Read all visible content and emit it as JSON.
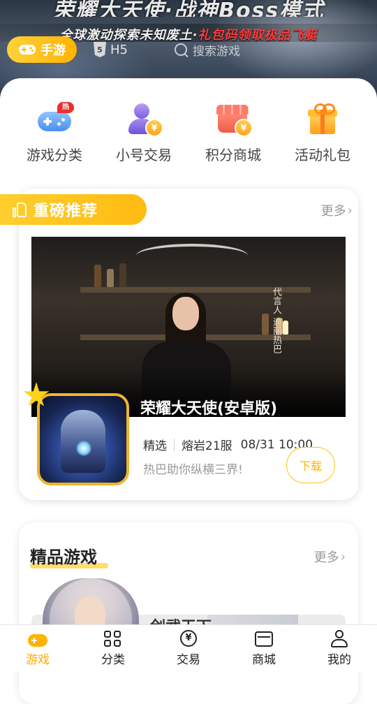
{
  "banner": {
    "headline": "荣耀大天使·战神Boss模式",
    "subline_part1": "全球激动探索未知废土·",
    "subline_part2": "礼包码领取极品飞艇",
    "platform_tag": "手游",
    "h5_label": "H5",
    "search_label": "搜索游戏"
  },
  "quick_menu": [
    {
      "label": "游戏分类",
      "icon": "gamepad-icon",
      "badge": "热"
    },
    {
      "label": "小号交易",
      "icon": "account-trade-icon"
    },
    {
      "label": "积分商城",
      "icon": "points-shop-icon"
    },
    {
      "label": "活动礼包",
      "icon": "gift-icon"
    }
  ],
  "featured": {
    "section_title": "重磅推荐",
    "more_label": "更多",
    "game_title": "荣耀大天使(安卓版)",
    "category": "精选",
    "server": "熔岩21服",
    "time": "08/31 10:00",
    "description": "热巴助你纵横三界!",
    "download_label": "下载",
    "image_caption": "代言人 迪丽热巴"
  },
  "premium": {
    "section_title": "精品游戏",
    "more_label": "更多",
    "game_name": "剑武天下"
  },
  "tabbar": [
    {
      "label": "游戏",
      "icon": "gamepad-icon",
      "active": true
    },
    {
      "label": "分类",
      "icon": "grid-icon",
      "active": false
    },
    {
      "label": "交易",
      "icon": "yen-icon",
      "active": false
    },
    {
      "label": "商城",
      "icon": "shop-icon",
      "active": false
    },
    {
      "label": "我的",
      "icon": "user-icon",
      "active": false
    }
  ],
  "colors": {
    "accent": "#ffb300",
    "ribbon": "#ffc61f",
    "hot_badge": "#e9302b"
  }
}
